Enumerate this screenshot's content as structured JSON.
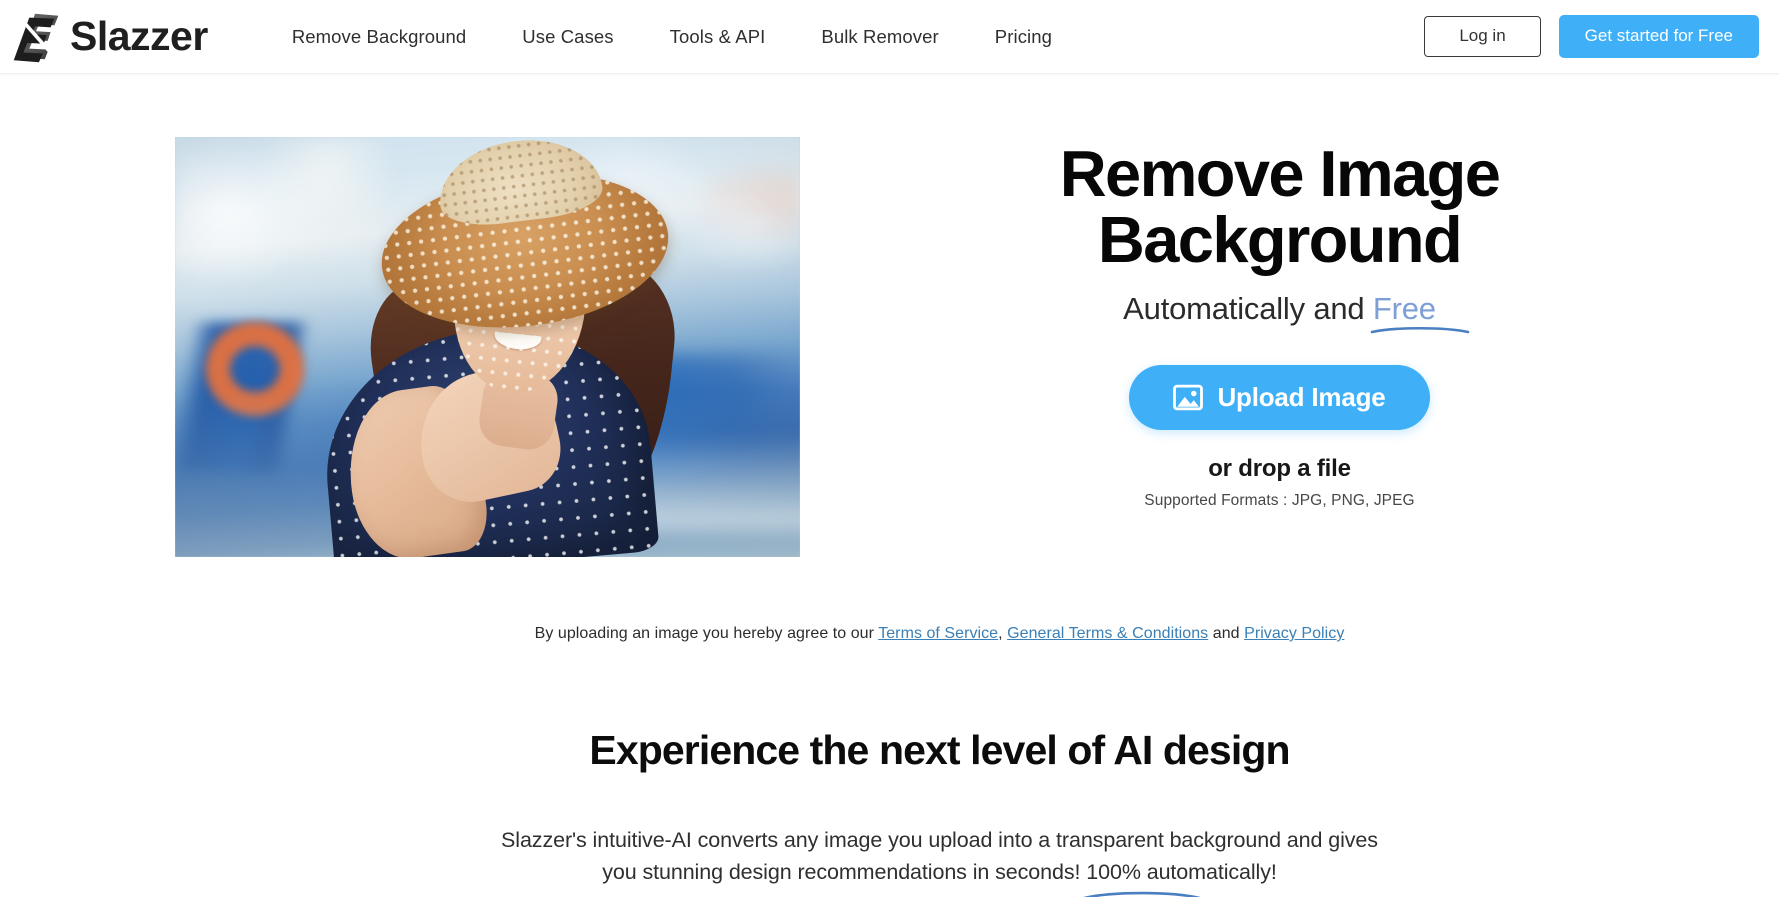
{
  "header": {
    "brand_name": "Slazzer",
    "logo_icon": "slazzer-diamond-logo",
    "nav": [
      {
        "label": "Remove Background"
      },
      {
        "label": "Use Cases"
      },
      {
        "label": "Tools & API"
      },
      {
        "label": "Bulk Remover"
      },
      {
        "label": "Pricing"
      }
    ],
    "login_label": "Log in",
    "get_started_label": "Get started for Free"
  },
  "hero": {
    "photo_alt": "Smiling woman wearing a straw sun hat at a harbour",
    "title": "Remove Image\nBackground",
    "sub_prefix": "Automatically and ",
    "sub_highlight": "Free",
    "upload_label": "Upload Image",
    "upload_icon": "image-upload-icon",
    "drop_text": "or drop a file",
    "formats": "Supported Formats : JPG, PNG, JPEG"
  },
  "terms": {
    "prefix": "By uploading an image you hereby agree to our ",
    "link1": "Terms of Service",
    "sep1": ", ",
    "link2": "General Terms & Conditions",
    "sep2": " and ",
    "link3": "Privacy Policy"
  },
  "section2": {
    "title": "Experience the next level of AI design",
    "body_line1": "Slazzer's intuitive-AI converts any image you upload into a transparent background and gives",
    "body_line2_prefix": "you stunning design recommendations in seconds! ",
    "body_line2_highlight": "100% automatically!"
  },
  "colors": {
    "accent_blue": "#3FB0F7",
    "link_blue": "#3a7fb5",
    "free_blue": "#7d9fd6",
    "swoosh_blue": "#4a7fc1",
    "text_dark": "#171717",
    "page_bg": "#ffffff"
  }
}
